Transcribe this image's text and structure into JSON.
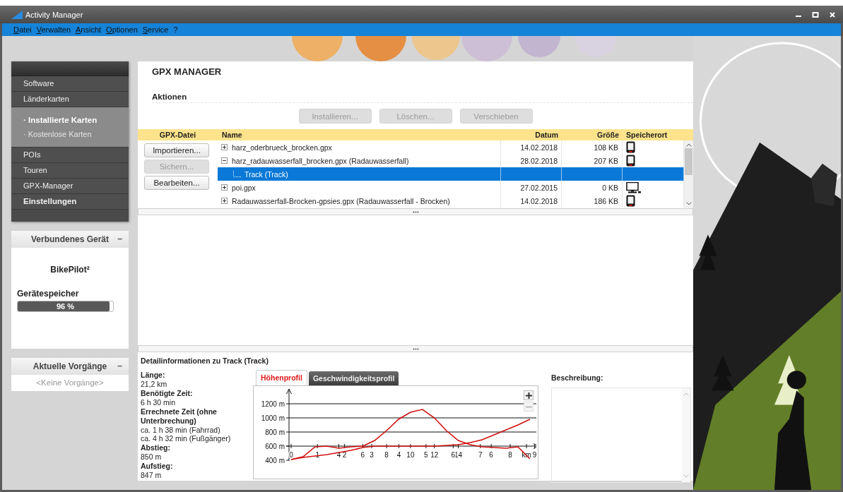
{
  "window": {
    "title": "Activity Manager"
  },
  "menu": [
    "Datei",
    "Verwalten",
    "Ansicht",
    "Optionen",
    "Service",
    "?"
  ],
  "sidebar": {
    "nav": [
      {
        "kind": "item",
        "label": "Software"
      },
      {
        "kind": "item",
        "label": "Länderkarten"
      },
      {
        "kind": "group",
        "children": [
          {
            "label": "· Installierte Karten",
            "selected": true
          },
          {
            "label": "· Kostenlose Karten",
            "selected": false
          }
        ]
      },
      {
        "kind": "item",
        "label": "POIs"
      },
      {
        "kind": "item",
        "label": "Touren"
      },
      {
        "kind": "item",
        "label": "GPX-Manager"
      },
      {
        "kind": "strong",
        "label": "Einstellungen"
      }
    ],
    "device_panel": {
      "title": "Verbundenes Gerät",
      "collapse": "–",
      "device": "BikePilot²",
      "storage_label": "Gerätespeicher",
      "storage": {
        "level": 0.96,
        "reading": "96 %"
      }
    },
    "tasks_panel": {
      "title": "Aktuelle Vorgänge",
      "collapse": "–",
      "empty": "<Keine Vorgänge>"
    }
  },
  "gpx": {
    "title": "GPX MANAGER",
    "section": "Aktionen",
    "actions": [
      {
        "label": "Installieren...",
        "disabled": true
      },
      {
        "label": "Löschen...",
        "disabled": true
      },
      {
        "label": "Verschieben",
        "disabled": true
      }
    ],
    "file_column": "GPX-Datei",
    "file_buttons": [
      {
        "label": "Importieren...",
        "disabled": false
      },
      {
        "label": "Sichern...",
        "disabled": true
      },
      {
        "label": "Bearbeiten...",
        "disabled": false
      }
    ],
    "columns": [
      "Name",
      "Datum",
      "Größe",
      "Speicherort"
    ],
    "rows": [
      {
        "name": "harz_oderbrueck_brocken.gpx",
        "date": "14.02.2018",
        "size": "108 KB",
        "kind": "device",
        "expanded": false,
        "selected": false
      },
      {
        "name": "harz_radauwasserfall_brocken.gpx (Radauwasserfall)",
        "date": "28.02.2018",
        "size": "207 KB",
        "kind": "device",
        "expanded": true,
        "selected": false,
        "children": [
          {
            "name": "Track (Track)",
            "selected": true
          }
        ]
      },
      {
        "name": "poi.gpx",
        "date": "27.02.2015",
        "size": "0 KB",
        "kind": "computer",
        "expanded": false,
        "selected": false
      },
      {
        "name": "Radauwasserfall-Brocken-gpsies.gpx (Radauwasserfall - Brocken)",
        "date": "14.02.2018",
        "size": "186 KB",
        "kind": "device",
        "expanded": false,
        "selected": false
      }
    ]
  },
  "detail": {
    "title": "Detailinformationen zu Track (Track)",
    "facts": [
      {
        "label": "Länge:",
        "values": [
          "21,2 km"
        ]
      },
      {
        "label": "Benötigte Zeit:",
        "values": [
          "6 h 30 min"
        ]
      },
      {
        "label": "Errechnete Zeit (ohne Unterbrechung)",
        "values": [
          "ca. 1 h 38 min (Fahrrad)",
          "ca. 4 h 32 min (Fußgänger)"
        ]
      },
      {
        "label": "Abstieg:",
        "values": [
          "850 m"
        ]
      },
      {
        "label": "Aufstieg:",
        "values": [
          "847 m"
        ]
      }
    ],
    "tabs": [
      {
        "label": "Höhenprofil",
        "selected": true
      },
      {
        "label": "Geschwindigkeitsprofil",
        "selected": false
      }
    ],
    "zoom_buttons": [
      {
        "kind": "in",
        "disabled": false
      },
      {
        "kind": "out",
        "disabled": true
      }
    ],
    "chart_data": {
      "type": "line",
      "grid": true,
      "x": [
        0,
        1,
        2,
        3,
        4,
        5,
        6,
        7,
        8,
        9,
        10,
        11,
        12,
        13,
        14,
        15,
        16,
        17,
        18,
        19,
        20
      ],
      "xlim": [
        0,
        20.6
      ],
      "ylim": [
        400,
        1410
      ],
      "yticks": [
        {
          "value": 400,
          "label": "400 m"
        },
        {
          "value": 600,
          "label": "600 m"
        },
        {
          "value": 800,
          "label": "800 m"
        },
        {
          "value": 1000,
          "label": "1000 m"
        },
        {
          "value": 1200,
          "label": "1200 m"
        }
      ],
      "xticks": [
        0,
        4,
        6,
        8,
        10,
        12,
        14
      ],
      "series": [
        {
          "color": "#d01010",
          "values": [
            410,
            450,
            590,
            600,
            570,
            590,
            600,
            680,
            820,
            980,
            1080,
            1120,
            1000,
            820,
            680,
            620,
            590,
            580,
            570,
            590,
            420
          ]
        },
        {
          "color": "#d01010",
          "values": [
            410,
            440,
            460,
            480,
            510,
            540,
            580,
            600,
            600,
            600,
            600,
            600,
            600,
            610,
            620,
            650,
            690,
            760,
            830,
            900,
            980
          ]
        }
      ]
    },
    "overlay_axis_labels": [
      "1",
      "2",
      "3",
      "4",
      "5",
      "6",
      "7",
      "6",
      "8",
      "km",
      "9"
    ],
    "description": {
      "label": "Beschreibung:"
    }
  }
}
